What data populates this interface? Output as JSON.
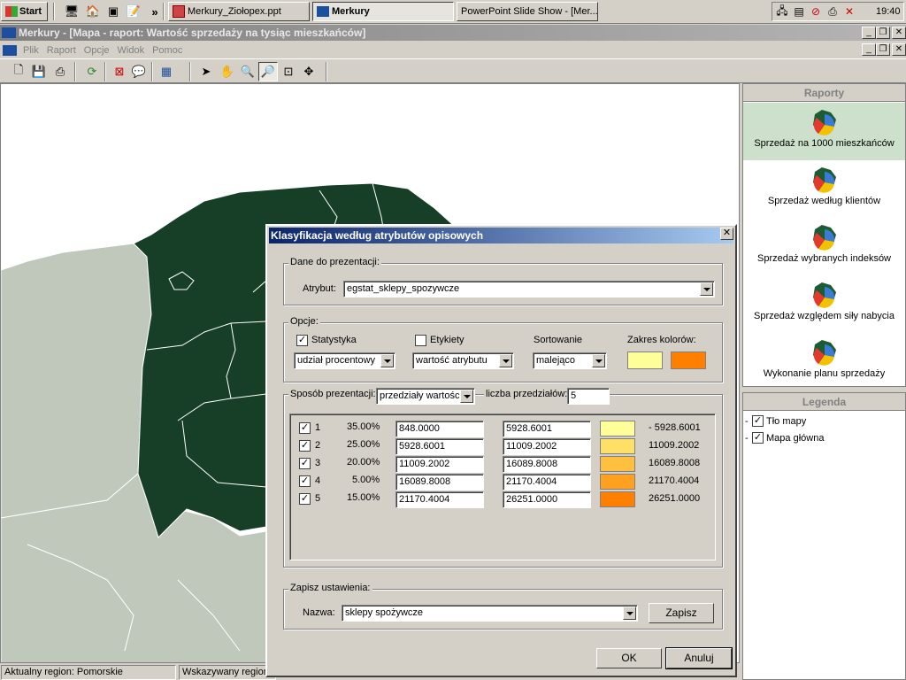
{
  "taskbar": {
    "start_label": "Start",
    "tasks": [
      "Merkury_Ziołopex.ppt",
      "Merkury",
      "PowerPoint Slide Show - [Mer..."
    ],
    "chevron": "»",
    "clock": "19:40"
  },
  "app": {
    "title": "Merkury - [Mapa - raport: Wartość sprzedaży na tysiąc mieszkańców]",
    "menu": [
      "Plik",
      "Raport",
      "Opcje",
      "Widok",
      "Pomoc"
    ]
  },
  "reports": {
    "header": "Raporty",
    "items": [
      {
        "label": "Sprzedaż na 1000 mieszkańców"
      },
      {
        "label": "Sprzedaż według klientów"
      },
      {
        "label": "Sprzedaż wybranych indeksów"
      },
      {
        "label": "Sprzedaż względem siły nabycia"
      },
      {
        "label": "Wykonanie planu sprzedaży"
      }
    ]
  },
  "legend": {
    "header": "Legenda",
    "items": [
      {
        "label": "Tło mapy",
        "checked": true
      },
      {
        "label": "Mapa główna",
        "checked": true
      }
    ]
  },
  "status": {
    "region": "Aktualny region: Pomorskie",
    "pointer": "Wskazywany region"
  },
  "dialog": {
    "title": "Klasyfikacja według atrybutów opisowych",
    "data_group": "Dane do prezentacji:",
    "attribute_label": "Atrybut:",
    "attribute_value": "egstat_sklepy_spozywcze",
    "options_group": "Opcje:",
    "statistics_label": "Statystyka",
    "statistics_checked": true,
    "labels_label": "Etykiety",
    "labels_checked": false,
    "sorting_label": "Sortowanie",
    "color_range_label": "Zakres kolorów:",
    "statistics_select": "udział procentowy",
    "labels_select": "wartość atrybutu",
    "sorting_select": "malejąco",
    "color_start": "#ffff99",
    "color_end": "#ff8000",
    "method_label": "Sposób prezentacji:",
    "method_value": "przedziały wartości",
    "count_label": "liczba przedziałów:",
    "count_value": "5",
    "intervals": [
      {
        "n": "1",
        "pct": "35.00%",
        "from": "848.0000",
        "to": "5928.6001",
        "color": "#ffff99",
        "range": "- 5928.6001"
      },
      {
        "n": "2",
        "pct": "25.00%",
        "from": "5928.6001",
        "to": "11009.2002",
        "color": "#ffe066",
        "range": "11009.2002"
      },
      {
        "n": "3",
        "pct": "20.00%",
        "from": "11009.2002",
        "to": "16089.8008",
        "color": "#ffc040",
        "range": "16089.8008"
      },
      {
        "n": "4",
        "pct": "5.00%",
        "from": "16089.8008",
        "to": "21170.4004",
        "color": "#ffa020",
        "range": "21170.4004"
      },
      {
        "n": "5",
        "pct": "15.00%",
        "from": "21170.4004",
        "to": "26251.0000",
        "color": "#ff8000",
        "range": "26251.0000"
      }
    ],
    "save_group": "Zapisz ustawienia:",
    "name_label": "Nazwa:",
    "name_value": "sklepy spożywcze",
    "save_button": "Zapisz",
    "ok_button": "OK",
    "cancel_button": "Anuluj"
  },
  "colors": {
    "map_dark_region": "#173f27",
    "map_neighbor": "#c0c8bc",
    "title_active": "#0a246a"
  }
}
